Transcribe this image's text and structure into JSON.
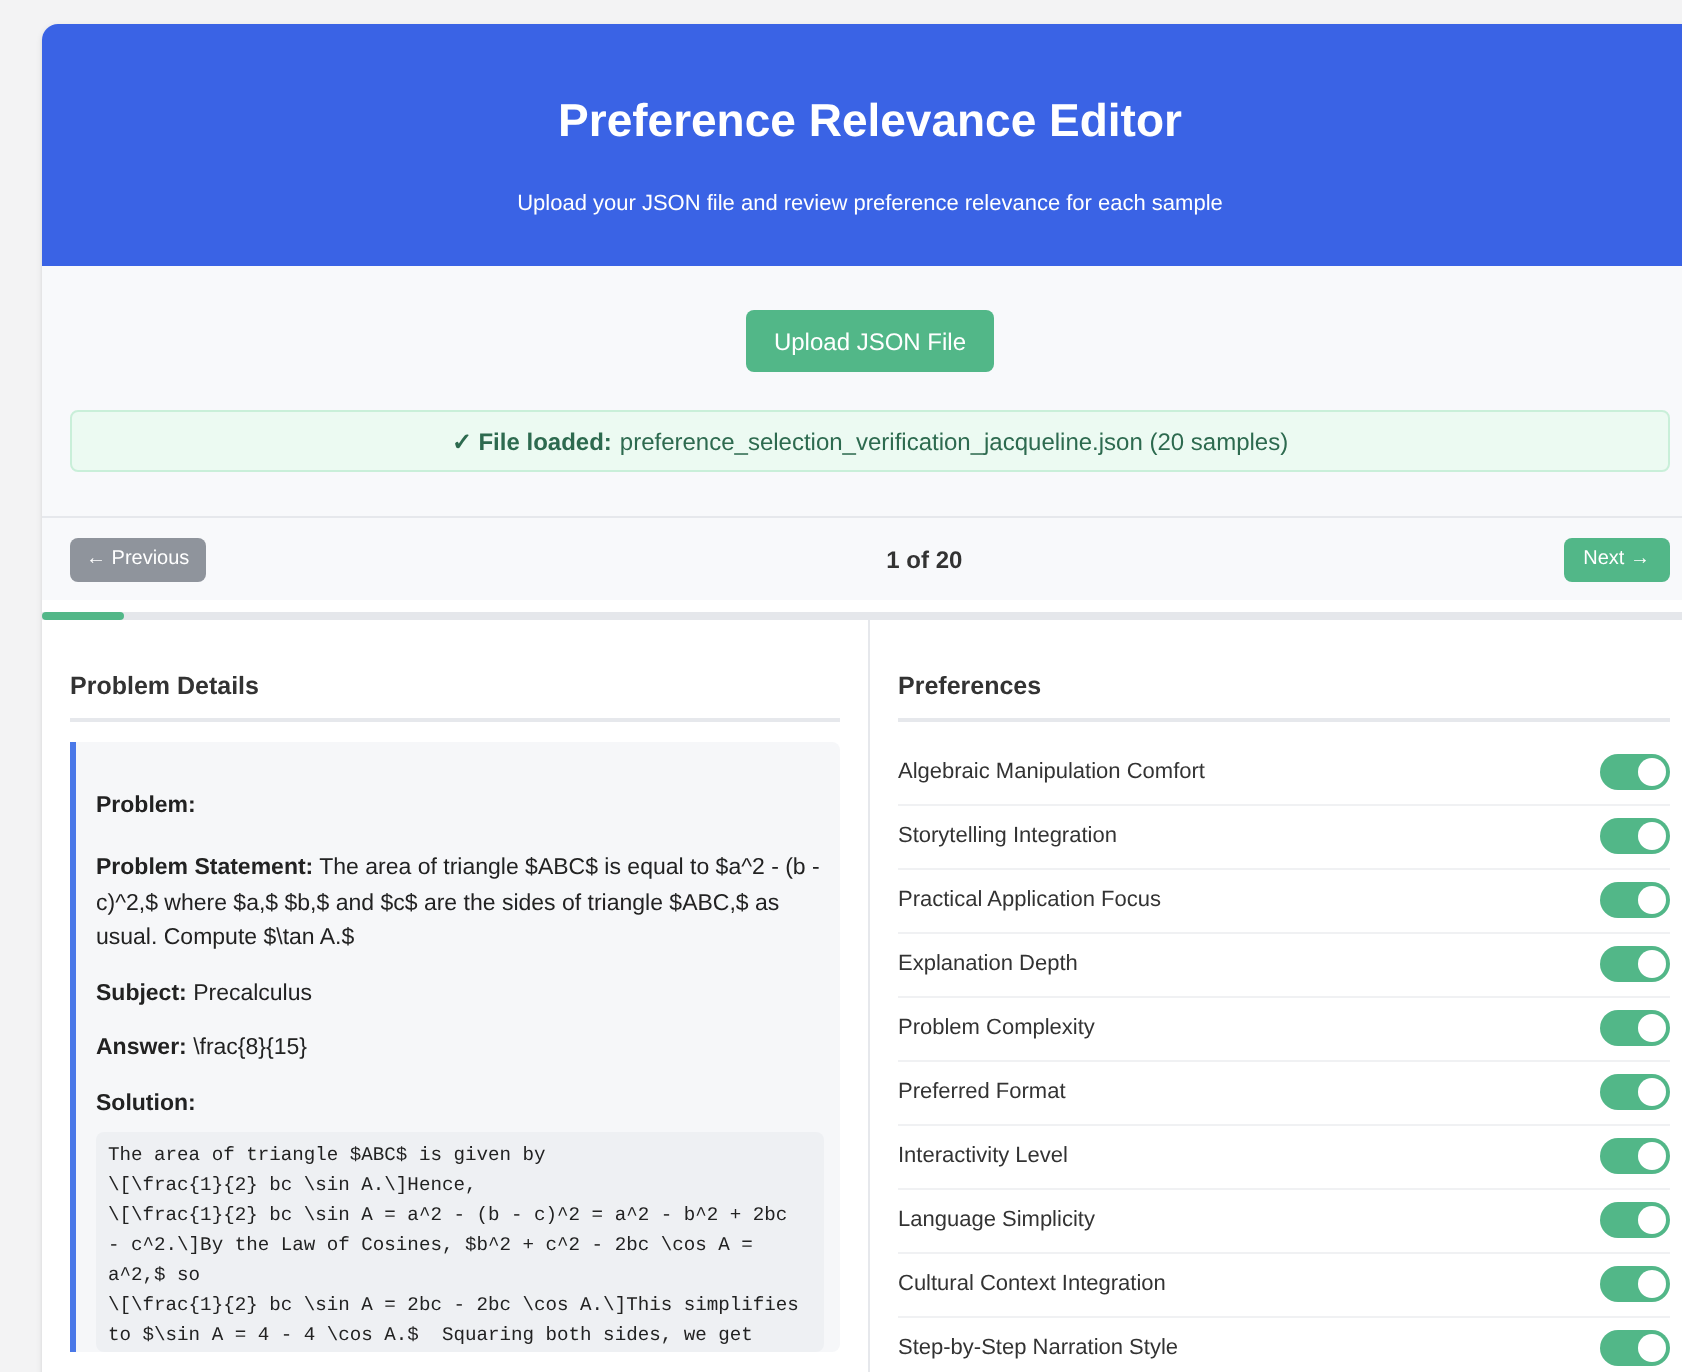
{
  "header": {
    "title": "Preference Relevance Editor",
    "subtitle": "Upload your JSON file and review preference relevance for each sample"
  },
  "upload_button": "Upload JSON File",
  "status": {
    "icon": "✓",
    "label": "File loaded:",
    "text": "preference_selection_verification_jacqueline.json (20 samples)"
  },
  "navigation": {
    "previous": {
      "label": "← Previous",
      "disabled": true
    },
    "counter": "1 of 20",
    "next": {
      "label": "Next →",
      "disabled": false
    },
    "progress": {
      "level": 0.05
    }
  },
  "problem_details": {
    "heading": "Problem Details",
    "fields": [
      {
        "kind": "heading",
        "label": "Problem:"
      },
      {
        "kind": "text",
        "label": "Problem Statement:",
        "value": "The area of triangle $ABC$ is equal to $a^2 - (b - c)^2,$ where $a,$ $b,$ and $c$ are the sides of triangle $ABC,$ as usual. Compute $\\tan A.$"
      },
      {
        "kind": "text",
        "label": "Subject:",
        "value": "Precalculus"
      },
      {
        "kind": "text",
        "label": "Answer:",
        "value": "\\frac{8}{15}"
      },
      {
        "kind": "code",
        "label": "Solution:",
        "value": "The area of triangle $ABC$ is given by\n\\[\\frac{1}{2} bc \\sin A.\\]Hence,\n\\[\\frac{1}{2} bc \\sin A = a^2 - (b - c)^2 = a^2 - b^2 + 2bc\n- c^2.\\]By the Law of Cosines, $b^2 + c^2 - 2bc \\cos A =\na^2,$ so\n\\[\\frac{1}{2} bc \\sin A = 2bc - 2bc \\cos A.\\]This simplifies\nto $\\sin A = 4 - 4 \\cos A.$  Squaring both sides, we get"
      }
    ]
  },
  "preferences": {
    "heading": "Preferences",
    "items": [
      {
        "label": "Algebraic Manipulation Comfort",
        "on": true
      },
      {
        "label": "Storytelling Integration",
        "on": true
      },
      {
        "label": "Practical Application Focus",
        "on": true
      },
      {
        "label": "Explanation Depth",
        "on": true
      },
      {
        "label": "Problem Complexity",
        "on": true
      },
      {
        "label": "Preferred Format",
        "on": true
      },
      {
        "label": "Interactivity Level",
        "on": true
      },
      {
        "label": "Language Simplicity",
        "on": true
      },
      {
        "label": "Cultural Context Integration",
        "on": true
      },
      {
        "label": "Step-by-Step Narration Style",
        "on": true
      }
    ]
  }
}
